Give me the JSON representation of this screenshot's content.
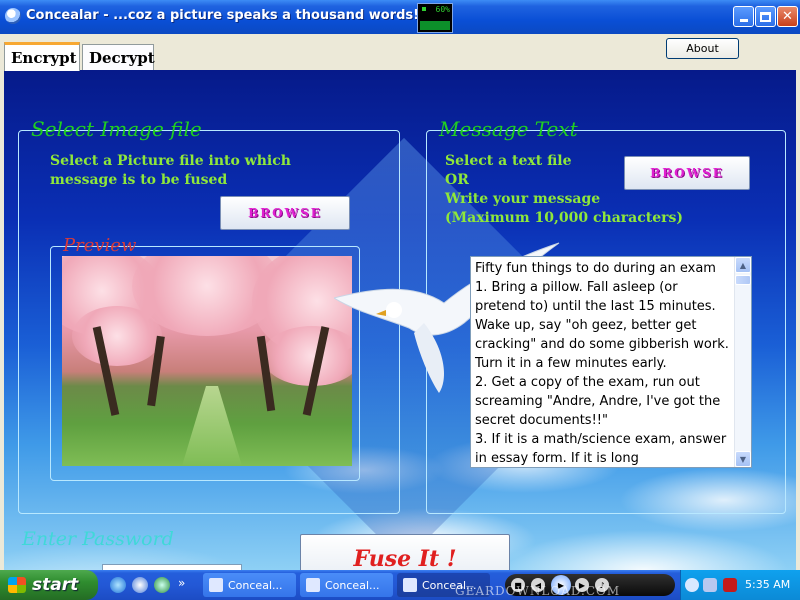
{
  "window": {
    "title": "Concealar - ...coz a picture speaks a thousand words!",
    "cpu_readout": "60%"
  },
  "tabs": [
    {
      "label": "Encrypt",
      "active": true
    },
    {
      "label": "Decrypt",
      "active": false
    }
  ],
  "about_label": "About",
  "image_group": {
    "legend": "Select Image file",
    "instruction": "Select a Picture file into which message is to be fused",
    "browse_label": "BROWSE",
    "preview_legend": "Preview"
  },
  "message_group": {
    "legend": "Message Text",
    "instruction_1": "Select a text file",
    "instruction_2": "OR",
    "instruction_3": "Write your message",
    "instruction_4": "(Maximum 10,000 characters)",
    "browse_label": "BROWSE",
    "text": "Fifty fun things to do during an exam\n1. Bring a pillow. Fall asleep (or pretend to) until the last 15 minutes. Wake up, say \"oh geez, better get cracking\" and do some gibberish work. Turn it in a few minutes early.\n2. Get a copy of the exam, run out screaming \"Andre, Andre, I've got the secret documents!!\"\n3. If it is a math/science exam, answer in essay form. If it is long"
  },
  "password": {
    "label": "Enter Password",
    "value": "••••••"
  },
  "fuse_label": "Fuse It !",
  "taskbar": {
    "start_label": "start",
    "tasks": [
      {
        "label": "Conceal...",
        "active": false
      },
      {
        "label": "Conceal...",
        "active": false
      },
      {
        "label": "Conceal...",
        "active": true
      }
    ],
    "clock": "5:35 AM",
    "watermark": "GEARDOWNLOAD.COM"
  },
  "colors": {
    "titlebar": "#0a4fd6",
    "legend_green": "#20d020",
    "preview_legend": "#d83a3a",
    "browse_text": "#e020d0",
    "fuse_text": "#e02020",
    "password_label": "#40d8d8"
  }
}
